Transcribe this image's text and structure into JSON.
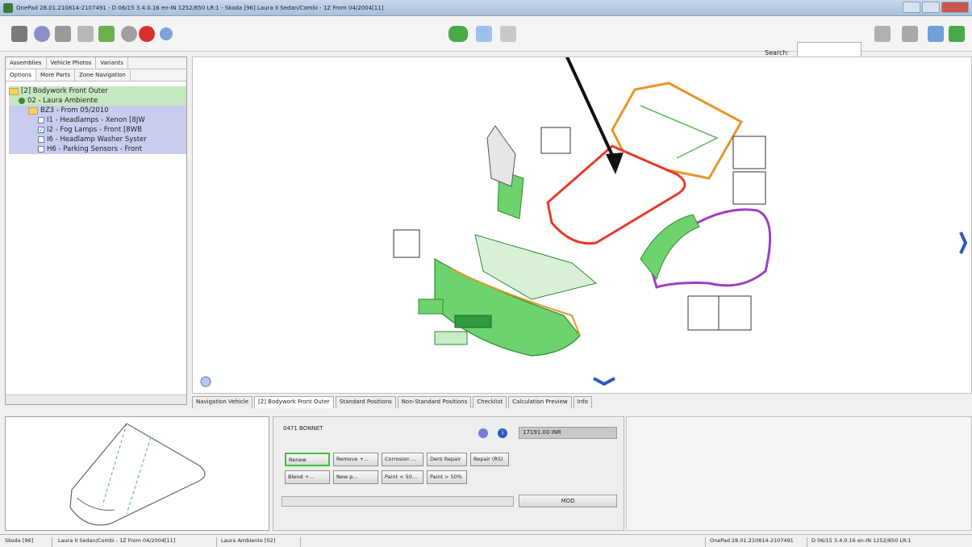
{
  "window": {
    "title": "OnePad 28.01.210814-2107491 - D 06/15 3.4.0.16 en-IN 1252/850 LR:1 - Skoda [96] Laura II Sedan/Combi - 1Z From 04/2004[11]"
  },
  "toolbar": {
    "search_label": "Search:",
    "search_value": "",
    "search_placeholder": ""
  },
  "left_tabs": {
    "row1": [
      "Assemblies",
      "Vehicle Photos",
      "Variants"
    ],
    "row2": [
      "Options",
      "More Parts",
      "Zone Navigation"
    ]
  },
  "tree": [
    {
      "label": "[2] Bodywork Front Outer",
      "kind": "folder",
      "checked": false
    },
    {
      "label": "02 - Laura Ambiente",
      "kind": "model",
      "checked": false
    },
    {
      "label": "BZ3 - From 05/2010",
      "kind": "folder",
      "checked": false
    },
    {
      "label": "I1 - Headlamps - Xenon [8JW",
      "kind": "item",
      "checked": false
    },
    {
      "label": "I2 - Fog Lamps - Front [8WB",
      "kind": "item",
      "checked": true
    },
    {
      "label": "I6 - Headlamp Washer Syster",
      "kind": "item",
      "checked": false
    },
    {
      "label": "H6 - Parking Sensors - Front",
      "kind": "item",
      "checked": false
    }
  ],
  "bottom_tabs": [
    "Navigation Vehicle",
    "[2] Bodywork Front Outer",
    "Standard Positions",
    "Non-Standard Positions",
    "Checklist",
    "Calculation Preview",
    "Info"
  ],
  "detail": {
    "part_name": "0471 BONNET",
    "price": "17191.00 INR",
    "buttons_row1": [
      "Renew",
      "Remove +...",
      "Corrosion ...",
      "Dent Repair",
      "Repair (RS)"
    ],
    "buttons_row2": [
      "Blend +...",
      "New p...",
      "Paint < 50...",
      "Paint > 50%"
    ],
    "mod_label": "MOD"
  },
  "status": {
    "make": "Skoda [96]",
    "model": "Laura II Sedan/Combi - 1Z From 04/2004[11]",
    "variant": "Laura Ambiente [02]",
    "version": "OnePad 28.01.210814-2107491",
    "locale": "D 06/15 3.4.0.16 en-IN 1252/850 LR:1"
  },
  "colors": {
    "selected_red": "#e83a2a",
    "selected_green": "#6ed36e",
    "orange": "#e7962d",
    "purple": "#9b3fc8",
    "accent_blue": "#2a5bbf"
  }
}
